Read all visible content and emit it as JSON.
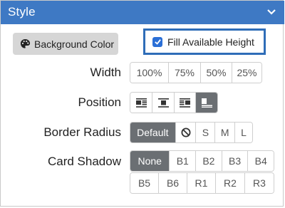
{
  "header": {
    "title": "Style",
    "chevron_icon": "chevron-down-icon"
  },
  "background_color_button": {
    "label": "Background Color",
    "icon": "palette-icon"
  },
  "fill_available_height": {
    "label": "Fill Available Height",
    "checked": true
  },
  "width": {
    "label": "Width",
    "options": [
      "100%",
      "75%",
      "50%",
      "25%"
    ]
  },
  "position": {
    "label": "Position",
    "options": [
      "align-left-icon",
      "align-center-icon",
      "align-right-icon",
      "align-bottom-icon"
    ],
    "selected": "align-bottom-icon"
  },
  "border_radius": {
    "label": "Border Radius",
    "options": [
      "Default",
      "S",
      "M",
      "L"
    ],
    "none_icon": "no-radius-icon",
    "selected": "Default"
  },
  "card_shadow": {
    "label": "Card Shadow",
    "row1": [
      "None",
      "B1",
      "B2",
      "B3",
      "B4"
    ],
    "row2": [
      "B5",
      "B6",
      "R1",
      "R2",
      "R3"
    ],
    "selected": "None"
  },
  "colors": {
    "header": "#3e79c4",
    "active": "#6b6f73",
    "highlight_border": "#2f6db8"
  }
}
